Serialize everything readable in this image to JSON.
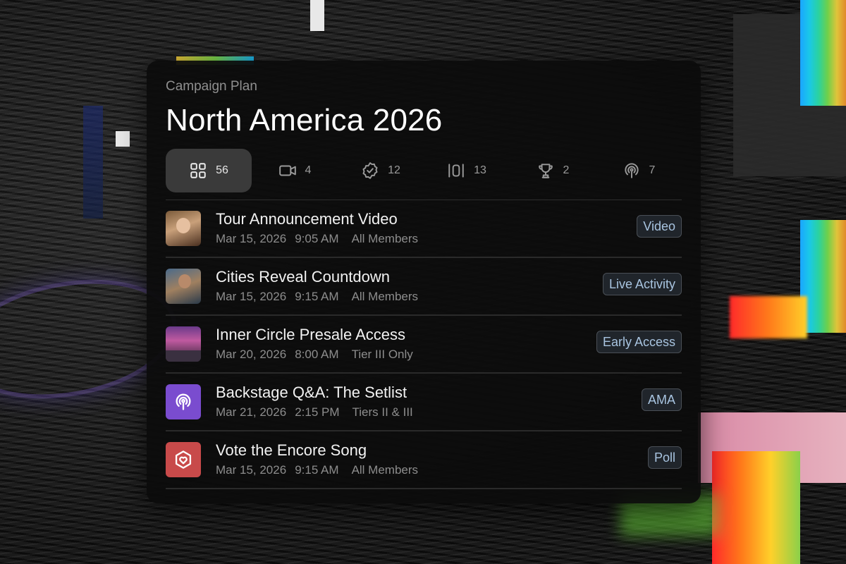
{
  "header": {
    "eyebrow": "Campaign Plan",
    "title": "North America 2026"
  },
  "tabs": [
    {
      "icon": "grid-icon",
      "count": "56",
      "active": true
    },
    {
      "icon": "video-icon",
      "count": "4",
      "active": false
    },
    {
      "icon": "verified-badge-icon",
      "count": "12",
      "active": false
    },
    {
      "icon": "live-activity-icon",
      "count": "13",
      "active": false
    },
    {
      "icon": "trophy-icon",
      "count": "2",
      "active": false
    },
    {
      "icon": "podcast-icon",
      "count": "7",
      "active": false
    }
  ],
  "items": [
    {
      "title": "Tour Announcement Video",
      "date": "Mar 15, 2026",
      "time": "9:05 AM",
      "audience": "All Members",
      "badge": "Video",
      "thumb": "photo"
    },
    {
      "title": "Cities Reveal Countdown",
      "date": "Mar 15, 2026",
      "time": "9:15 AM",
      "audience": "All Members",
      "badge": "Live Activity",
      "thumb": "photo"
    },
    {
      "title": "Inner Circle Presale Access",
      "date": "Mar 20, 2026",
      "time": "8:00 AM",
      "audience": "Tier III Only",
      "badge": "Early Access",
      "thumb": "photo"
    },
    {
      "title": "Backstage Q&A: The Setlist",
      "date": "Mar 21, 2026",
      "time": "2:15 PM",
      "audience": "Tiers II & III",
      "badge": "AMA",
      "thumb": "podcast-icon"
    },
    {
      "title": "Vote the Encore Song",
      "date": "Mar 15, 2026",
      "time": "9:15 AM",
      "audience": "All Members",
      "badge": "Poll",
      "thumb": "heart-hexagon-icon"
    }
  ],
  "colors": {
    "card_bg": "#0c0c0c",
    "active_tab_bg": "#3a3a3a",
    "badge_text": "#a8c4e0",
    "ama_thumb": "#7a4ccf",
    "poll_thumb": "#c84a4a"
  }
}
